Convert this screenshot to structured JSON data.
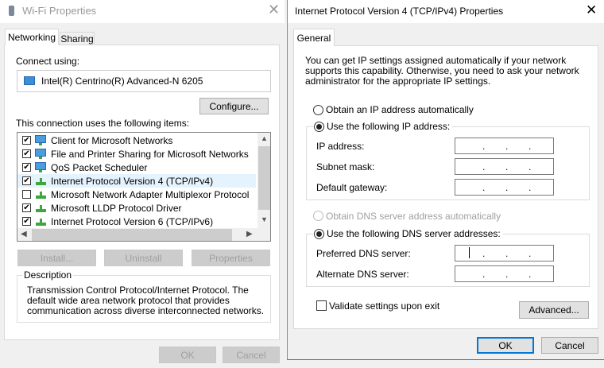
{
  "wifi": {
    "title": "Wi-Fi Properties",
    "tabs": [
      "Networking",
      "Sharing"
    ],
    "connect_using_label": "Connect using:",
    "adapter": "Intel(R) Centrino(R) Advanced-N 6205",
    "configure": "Configure...",
    "items_label": "This connection uses the following items:",
    "items": [
      {
        "label": "Client for Microsoft Networks",
        "checked": true,
        "icon": "network-client-icon"
      },
      {
        "label": "File and Printer Sharing for Microsoft Networks",
        "checked": true,
        "icon": "network-service-icon"
      },
      {
        "label": "QoS Packet Scheduler",
        "checked": true,
        "icon": "network-service-icon"
      },
      {
        "label": "Internet Protocol Version 4 (TCP/IPv4)",
        "checked": true,
        "icon": "protocol-icon"
      },
      {
        "label": "Microsoft Network Adapter Multiplexor Protocol",
        "checked": false,
        "icon": "protocol-icon"
      },
      {
        "label": "Microsoft LLDP Protocol Driver",
        "checked": true,
        "icon": "protocol-icon"
      },
      {
        "label": "Internet Protocol Version 6 (TCP/IPv6)",
        "checked": true,
        "icon": "protocol-icon"
      }
    ],
    "install": "Install...",
    "uninstall": "Uninstall",
    "properties": "Properties",
    "description_label": "Description",
    "description": "Transmission Control Protocol/Internet Protocol. The default wide area network protocol that provides communication across diverse interconnected networks.",
    "ok": "OK",
    "cancel": "Cancel"
  },
  "ipv4": {
    "title": "Internet Protocol Version 4 (TCP/IPv4) Properties",
    "tab": "General",
    "intro": "You can get IP settings assigned automatically if your network supports this capability. Otherwise, you need to ask your network administrator for the appropriate IP settings.",
    "obtain_ip": "Obtain an IP address automatically",
    "use_ip": "Use the following IP address:",
    "ip_label": "IP address:",
    "subnet_label": "Subnet mask:",
    "gateway_label": "Default gateway:",
    "obtain_dns": "Obtain DNS server address automatically",
    "use_dns": "Use the following DNS server addresses:",
    "preferred_label": "Preferred DNS server:",
    "alternate_label": "Alternate DNS server:",
    "validate": "Validate settings upon exit",
    "advanced": "Advanced...",
    "ok": "OK",
    "cancel": "Cancel",
    "dot": "."
  },
  "colors": {
    "focus": "#0078d7",
    "selected_row": "#e5f3ff"
  }
}
